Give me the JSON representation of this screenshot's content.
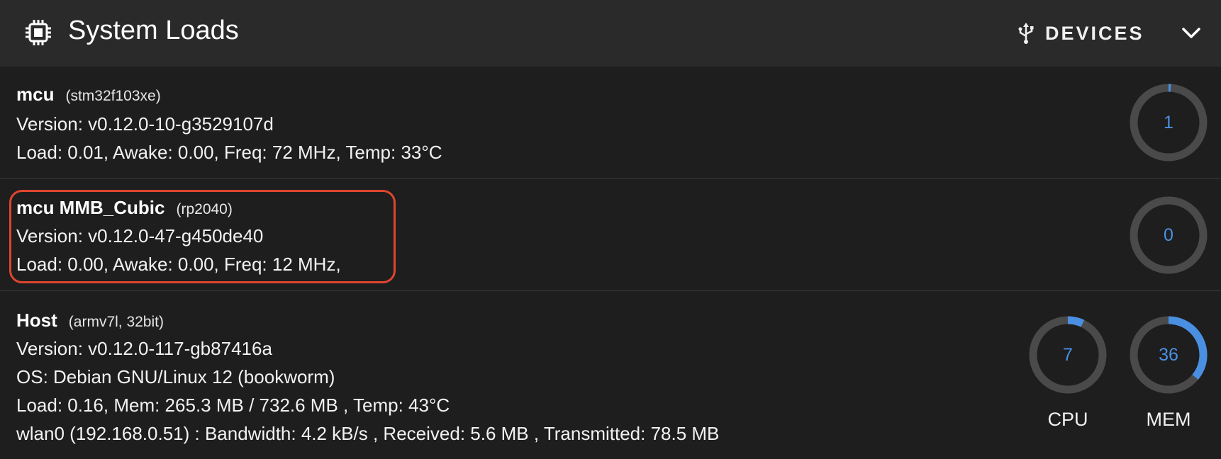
{
  "header": {
    "title": "System Loads",
    "devices_label": "DEVICES",
    "icons": {
      "title": "chip-icon",
      "devices": "usb-icon",
      "collapse": "chevron-down-icon"
    }
  },
  "mcus": [
    {
      "name": "mcu",
      "chip": "(stm32f103xe)",
      "version": "Version: v0.12.0-10-g3529107d",
      "stats": "Load: 0.01, Awake: 0.00, Freq: 72 MHz, Temp: 33°C",
      "gauge_value": "1",
      "gauge_percent": 1
    },
    {
      "name": "mcu MMB_Cubic",
      "chip": "(rp2040)",
      "version": "Version: v0.12.0-47-g450de40",
      "stats": "Load: 0.00, Awake: 0.00, Freq: 12 MHz,",
      "gauge_value": "0",
      "gauge_percent": 0
    }
  ],
  "host": {
    "name": "Host",
    "arch": "(armv7l, 32bit)",
    "version": "Version: v0.12.0-117-gb87416a",
    "os": "OS: Debian GNU/Linux 12 (bookworm)",
    "stats": "Load: 0.16, Mem: 265.3 MB / 732.6 MB , Temp: 43°C",
    "network": "wlan0 (192.168.0.51) : Bandwidth: 4.2 kB/s , Received: 5.6 MB , Transmitted: 78.5 MB",
    "cpu": {
      "value": "7",
      "percent": 7,
      "label": "CPU"
    },
    "mem": {
      "value": "36",
      "percent": 36,
      "label": "MEM"
    }
  },
  "colors": {
    "accent": "#4a90e2",
    "gauge_track": "#4a4a4a",
    "highlight": "#e0452f",
    "header_bg": "#2a2a2a",
    "panel_bg": "#1e1e1e"
  }
}
